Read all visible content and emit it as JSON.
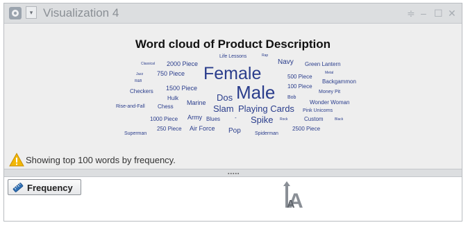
{
  "window": {
    "title": "Visualization 4",
    "caret_glyph": "▾",
    "controls": {
      "menu_glyph": "≑",
      "minimize_glyph": "‒",
      "maximize_glyph": "☐",
      "close_glyph": "✕"
    }
  },
  "cloud": {
    "title": "Word cloud of Product Description",
    "word_color": "#2a3d8c",
    "words": [
      {
        "text": "Life Lessons"
      },
      {
        "text": "Rap"
      },
      {
        "text": "Classical"
      },
      {
        "text": "2000 Piece"
      },
      {
        "text": "Navy"
      },
      {
        "text": "Green Lantern"
      },
      {
        "text": "Jazz"
      },
      {
        "text": "750 Piece"
      },
      {
        "text": "Female"
      },
      {
        "text": "Metal"
      },
      {
        "text": "R&B"
      },
      {
        "text": "500 Piece"
      },
      {
        "text": "Backgammon"
      },
      {
        "text": "1500 Piece"
      },
      {
        "text": "100 Piece"
      },
      {
        "text": "Checkers"
      },
      {
        "text": "Male"
      },
      {
        "text": "Money Pit"
      },
      {
        "text": "Hulk"
      },
      {
        "text": "Dos"
      },
      {
        "text": "Bob"
      },
      {
        "text": "Marine"
      },
      {
        "text": "Wonder Woman"
      },
      {
        "text": "Rise-and-Fall"
      },
      {
        "text": "Chess"
      },
      {
        "text": "Slam"
      },
      {
        "text": "Playing Cards"
      },
      {
        "text": "Pink Unicorns"
      },
      {
        "text": "Army"
      },
      {
        "text": "1000 Piece"
      },
      {
        "text": "Blues"
      },
      {
        "text": "-"
      },
      {
        "text": "Spike"
      },
      {
        "text": "Rock"
      },
      {
        "text": "Custom"
      },
      {
        "text": "Black"
      },
      {
        "text": "250 Piece"
      },
      {
        "text": "Air Force"
      },
      {
        "text": "Pop"
      },
      {
        "text": "2500 Piece"
      },
      {
        "text": "Superman"
      },
      {
        "text": "Spiderman"
      }
    ]
  },
  "notice": {
    "text": "Showing top 100 words by frequency.",
    "icon": "warning-icon"
  },
  "splitter": {
    "grip": "▪▪▪▪▪"
  },
  "frequency_button": {
    "label": "Frequency",
    "icon": "ruler-icon"
  },
  "text_size_indicator": {
    "icon": "text-size-icon",
    "letter": "A"
  }
}
